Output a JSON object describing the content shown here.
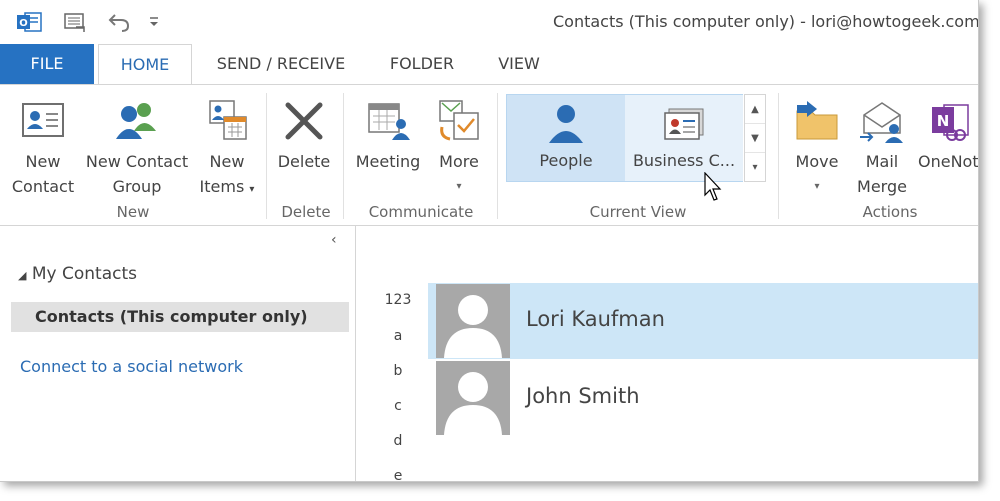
{
  "window": {
    "title": "Contacts (This computer only) - lori@howtogeek.com"
  },
  "qat": {
    "icons": [
      "outlook-icon",
      "send-receive-all-icon",
      "undo-icon",
      "customize-qat-icon"
    ]
  },
  "tabs": [
    {
      "label": "FILE"
    },
    {
      "label": "HOME"
    },
    {
      "label": "SEND / RECEIVE"
    },
    {
      "label": "FOLDER"
    },
    {
      "label": "VIEW"
    }
  ],
  "ribbon": {
    "groups": {
      "new": "New",
      "delete": "Delete",
      "communicate": "Communicate",
      "current_view": "Current View",
      "actions": "Actions"
    },
    "buttons": {
      "new_contact": [
        "New",
        "Contact"
      ],
      "new_contact_group": [
        "New Contact",
        "Group"
      ],
      "new_items": [
        "New",
        "Items"
      ],
      "delete": "Delete",
      "meeting": "Meeting",
      "more": "More",
      "move": "Move",
      "mail_merge": [
        "Mail",
        "Merge"
      ],
      "onenote": "OneNote"
    },
    "views": {
      "people": "People",
      "business_card": "Business C..."
    },
    "accent": "#2672c2",
    "selected_view_bg": "#cfe3f5"
  },
  "nav": {
    "section": "My Contacts",
    "folder": "Contacts (This computer only)",
    "social_link": "Connect to a social network"
  },
  "index": [
    "123",
    "a",
    "b",
    "c",
    "d",
    "e"
  ],
  "contacts": [
    {
      "name": "Lori Kaufman",
      "selected": true
    },
    {
      "name": "John Smith",
      "selected": false
    }
  ]
}
